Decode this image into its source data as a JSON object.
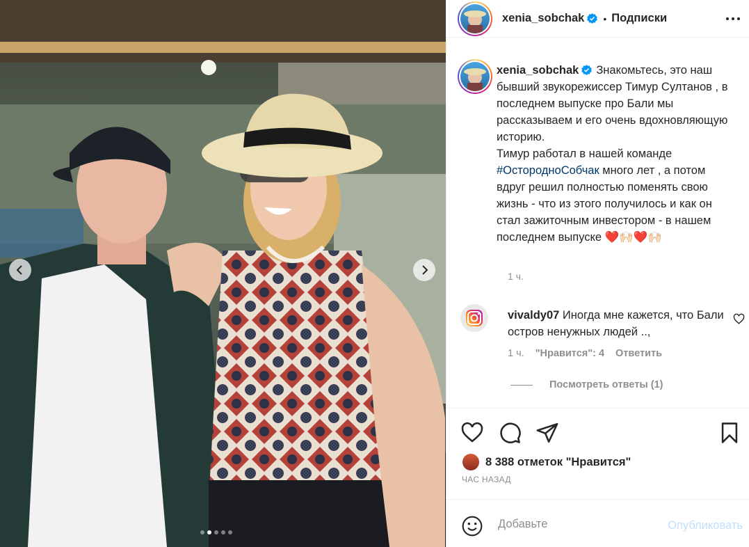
{
  "post": {
    "author": "xenia_sobchak",
    "follow_status": "Подписки",
    "dot": "•",
    "verified_icon": "verified-badge-icon",
    "accent_color": "#0095f6"
  },
  "media": {
    "image_alt": "",
    "carousel_total": 5,
    "carousel_current": 2
  },
  "caption": {
    "text_before_hashtag": "Знакомьтесь, это наш бывший звукорежиссер Тимур Султанов , в последнем выпуске про Бали мы рассказываем и его очень вдохновляющую историю.",
    "line2_before_hashtag": "Тимур работал в нашей команде",
    "hashtag": "#ОстородноСобчак",
    "text_after_hashtag": "много лет , а потом вдруг решил полностью поменять свою жизнь - что из этого получилось и как он стал зажиточным инвестором - в нашем последнем выпуске ❤️🙌🏻❤️🙌🏻",
    "time": "1 ч."
  },
  "comment": {
    "author": "vivaldy07",
    "text": "Иногда мне кажется, что Бали остров ненужных людей ..,",
    "time": "1 ч.",
    "likes": "\"Нравится\": 4",
    "reply": "Ответить",
    "view_replies": "Посмотреть ответы (1)"
  },
  "engagement": {
    "likes_label": "8 388 отметок \"Нравится\"",
    "posted": "ЧАС НАЗАД"
  },
  "compose": {
    "placeholder": "Добавьте",
    "publish": "Опубликовать"
  }
}
